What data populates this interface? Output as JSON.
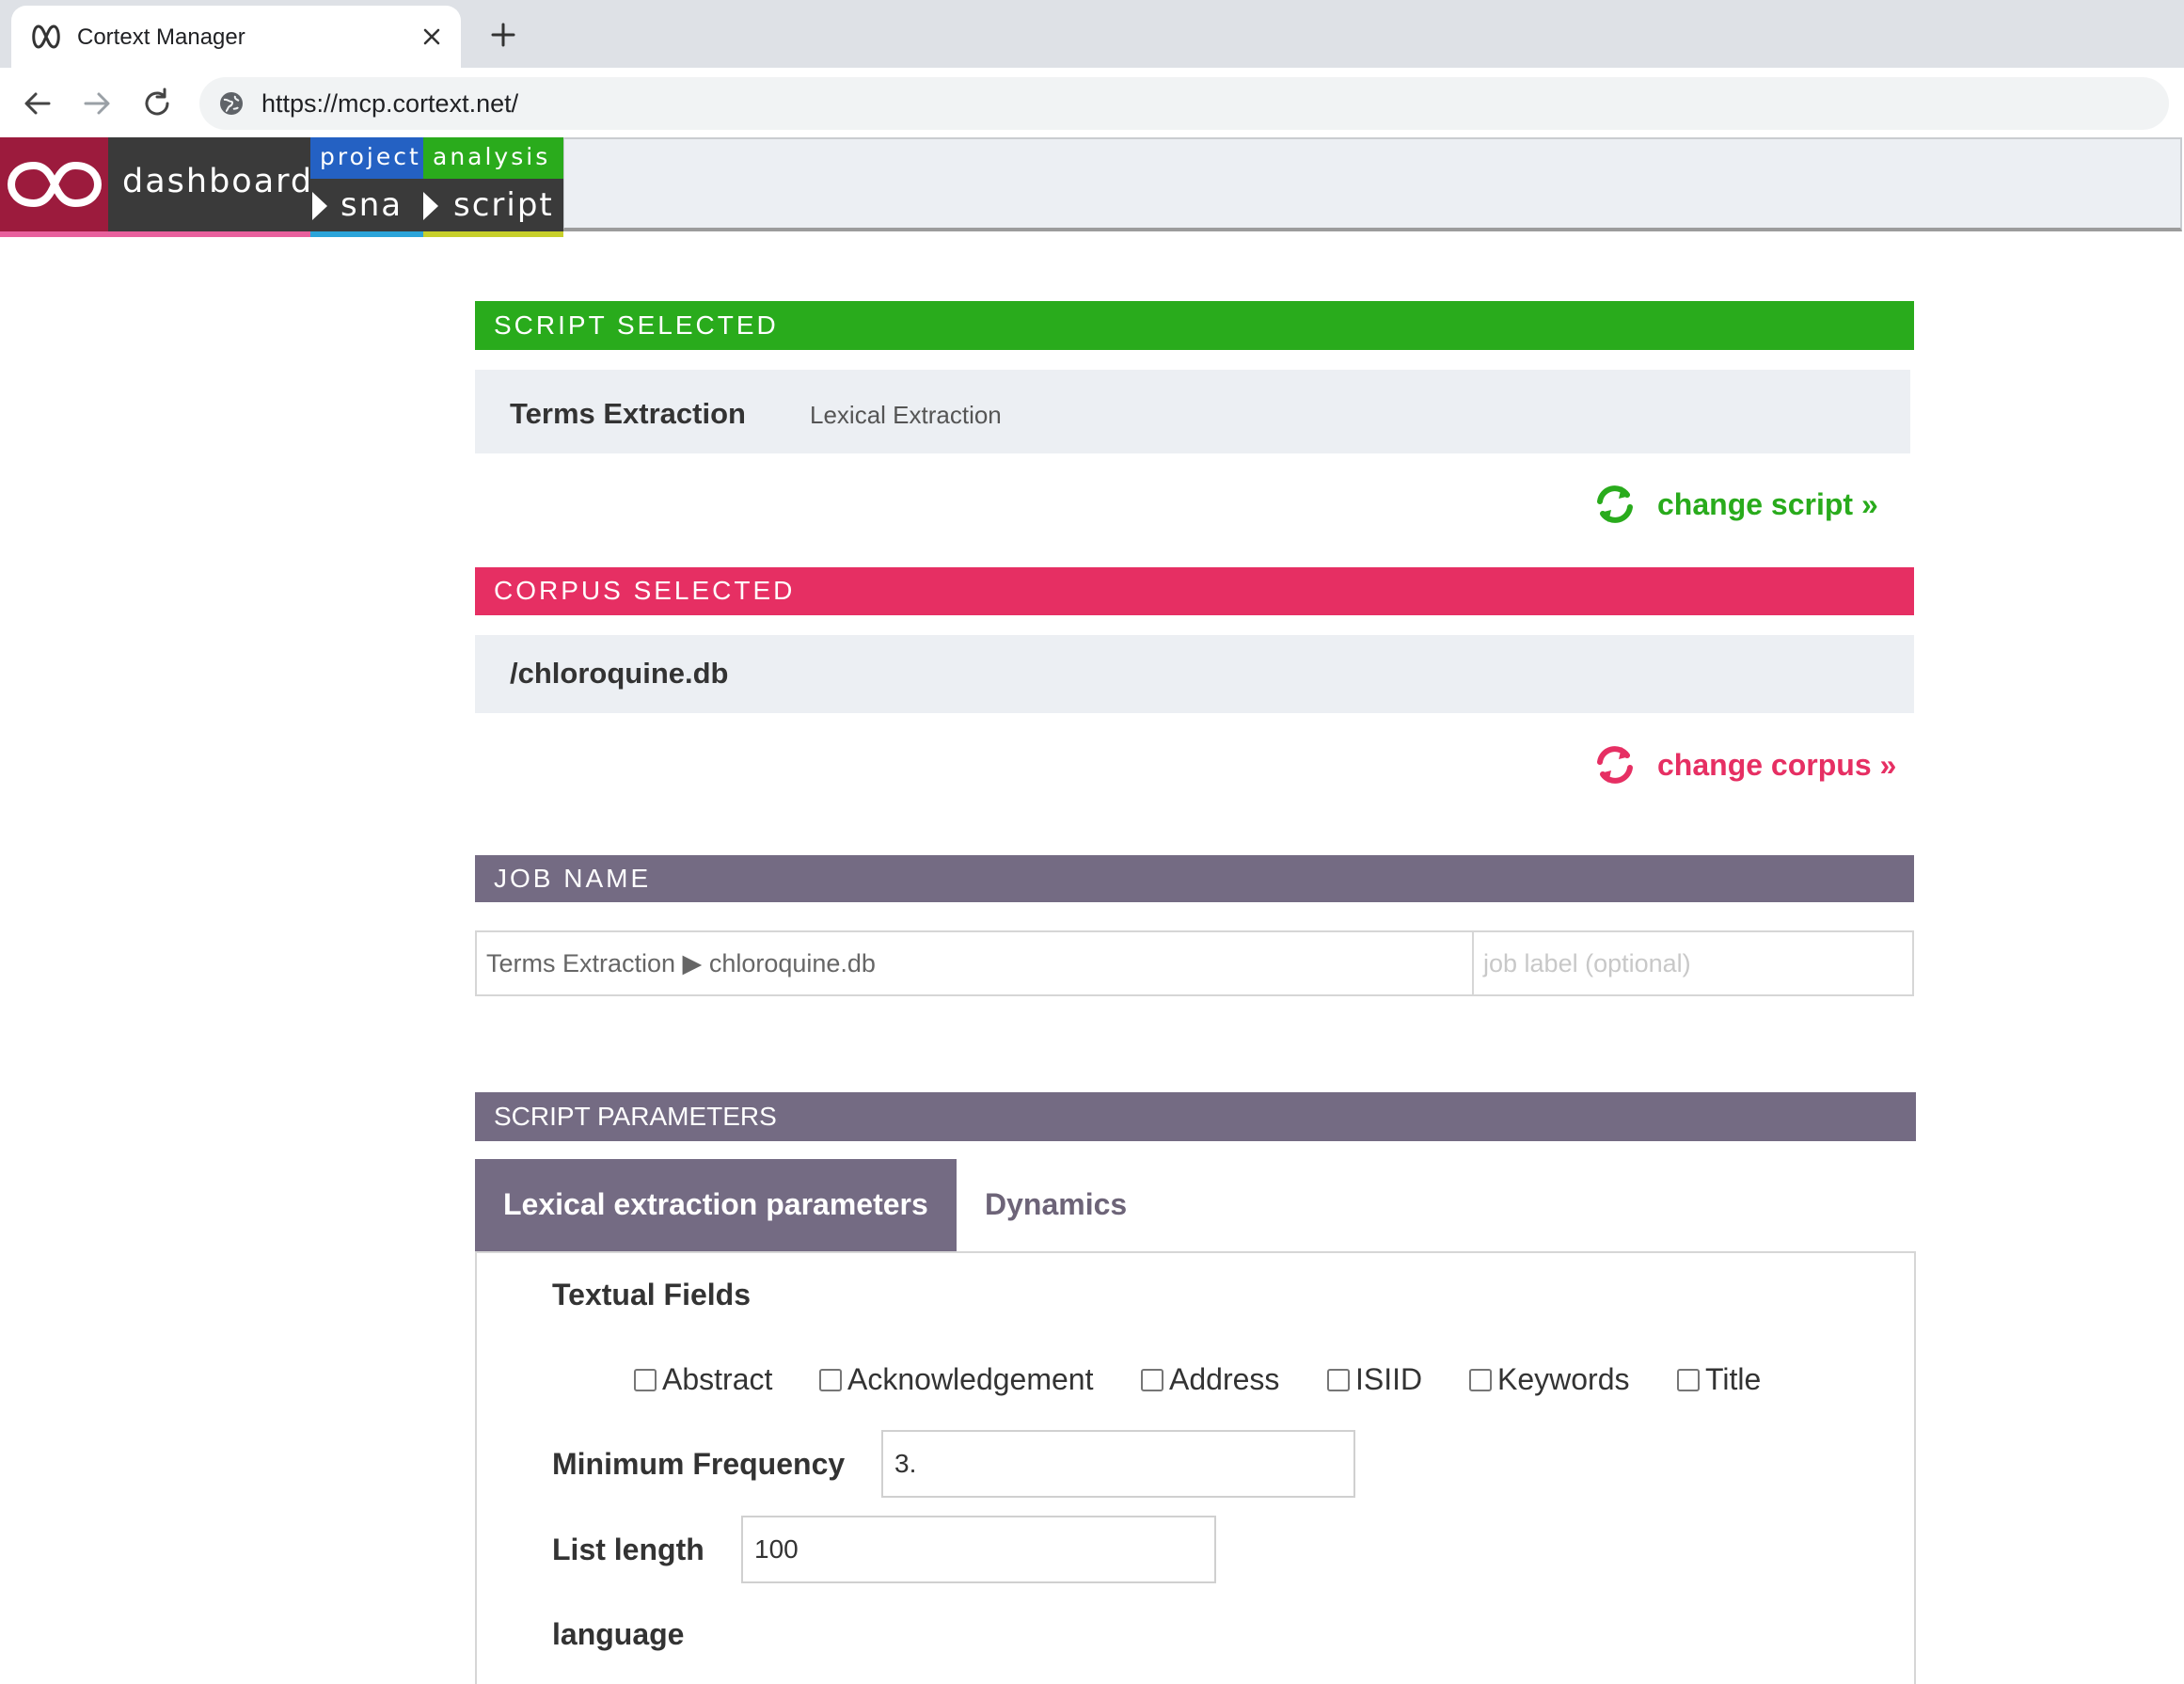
{
  "browser": {
    "tab_title": "Cortext Manager",
    "url": "https://mcp.cortext.net/"
  },
  "header": {
    "dashboard_label": "dashboard",
    "crumbs": [
      {
        "top": "project",
        "bottom": "sna",
        "color": "#2461c3",
        "strip": "#2ba4d9"
      },
      {
        "top": "analysis",
        "bottom": "script",
        "color": "#2aab1c",
        "strip": "#c7cf2a"
      }
    ]
  },
  "script_section": {
    "header": "SCRIPT SELECTED",
    "color": "#29ab1c",
    "script_name": "Terms Extraction",
    "script_type": "Lexical Extraction",
    "change_label": "change script »"
  },
  "corpus_section": {
    "header": "CORPUS SELECTED",
    "color": "#e62f63",
    "corpus_name": "/chloroquine.db",
    "change_label": "change corpus »"
  },
  "job_section": {
    "header": "JOB NAME",
    "color": "#746b83",
    "job_name": "Terms Extraction ▶ chloroquine.db",
    "label_placeholder": "job label (optional)"
  },
  "params_section": {
    "header": "SCRIPT PARAMETERS",
    "tabs": [
      "Lexical extraction parameters",
      "Dynamics"
    ],
    "textual_fields_label": "Textual Fields",
    "textual_fields": [
      {
        "label": "Abstract",
        "checked": false
      },
      {
        "label": "Acknowledgement",
        "checked": false
      },
      {
        "label": "Address",
        "checked": false
      },
      {
        "label": "ISIID",
        "checked": false
      },
      {
        "label": "Keywords",
        "checked": false
      },
      {
        "label": "Title",
        "checked": false
      }
    ],
    "min_freq_label": "Minimum Frequency",
    "min_freq_value": "3.",
    "list_length_label": "List length",
    "list_length_value": "100",
    "language_label": "language"
  }
}
